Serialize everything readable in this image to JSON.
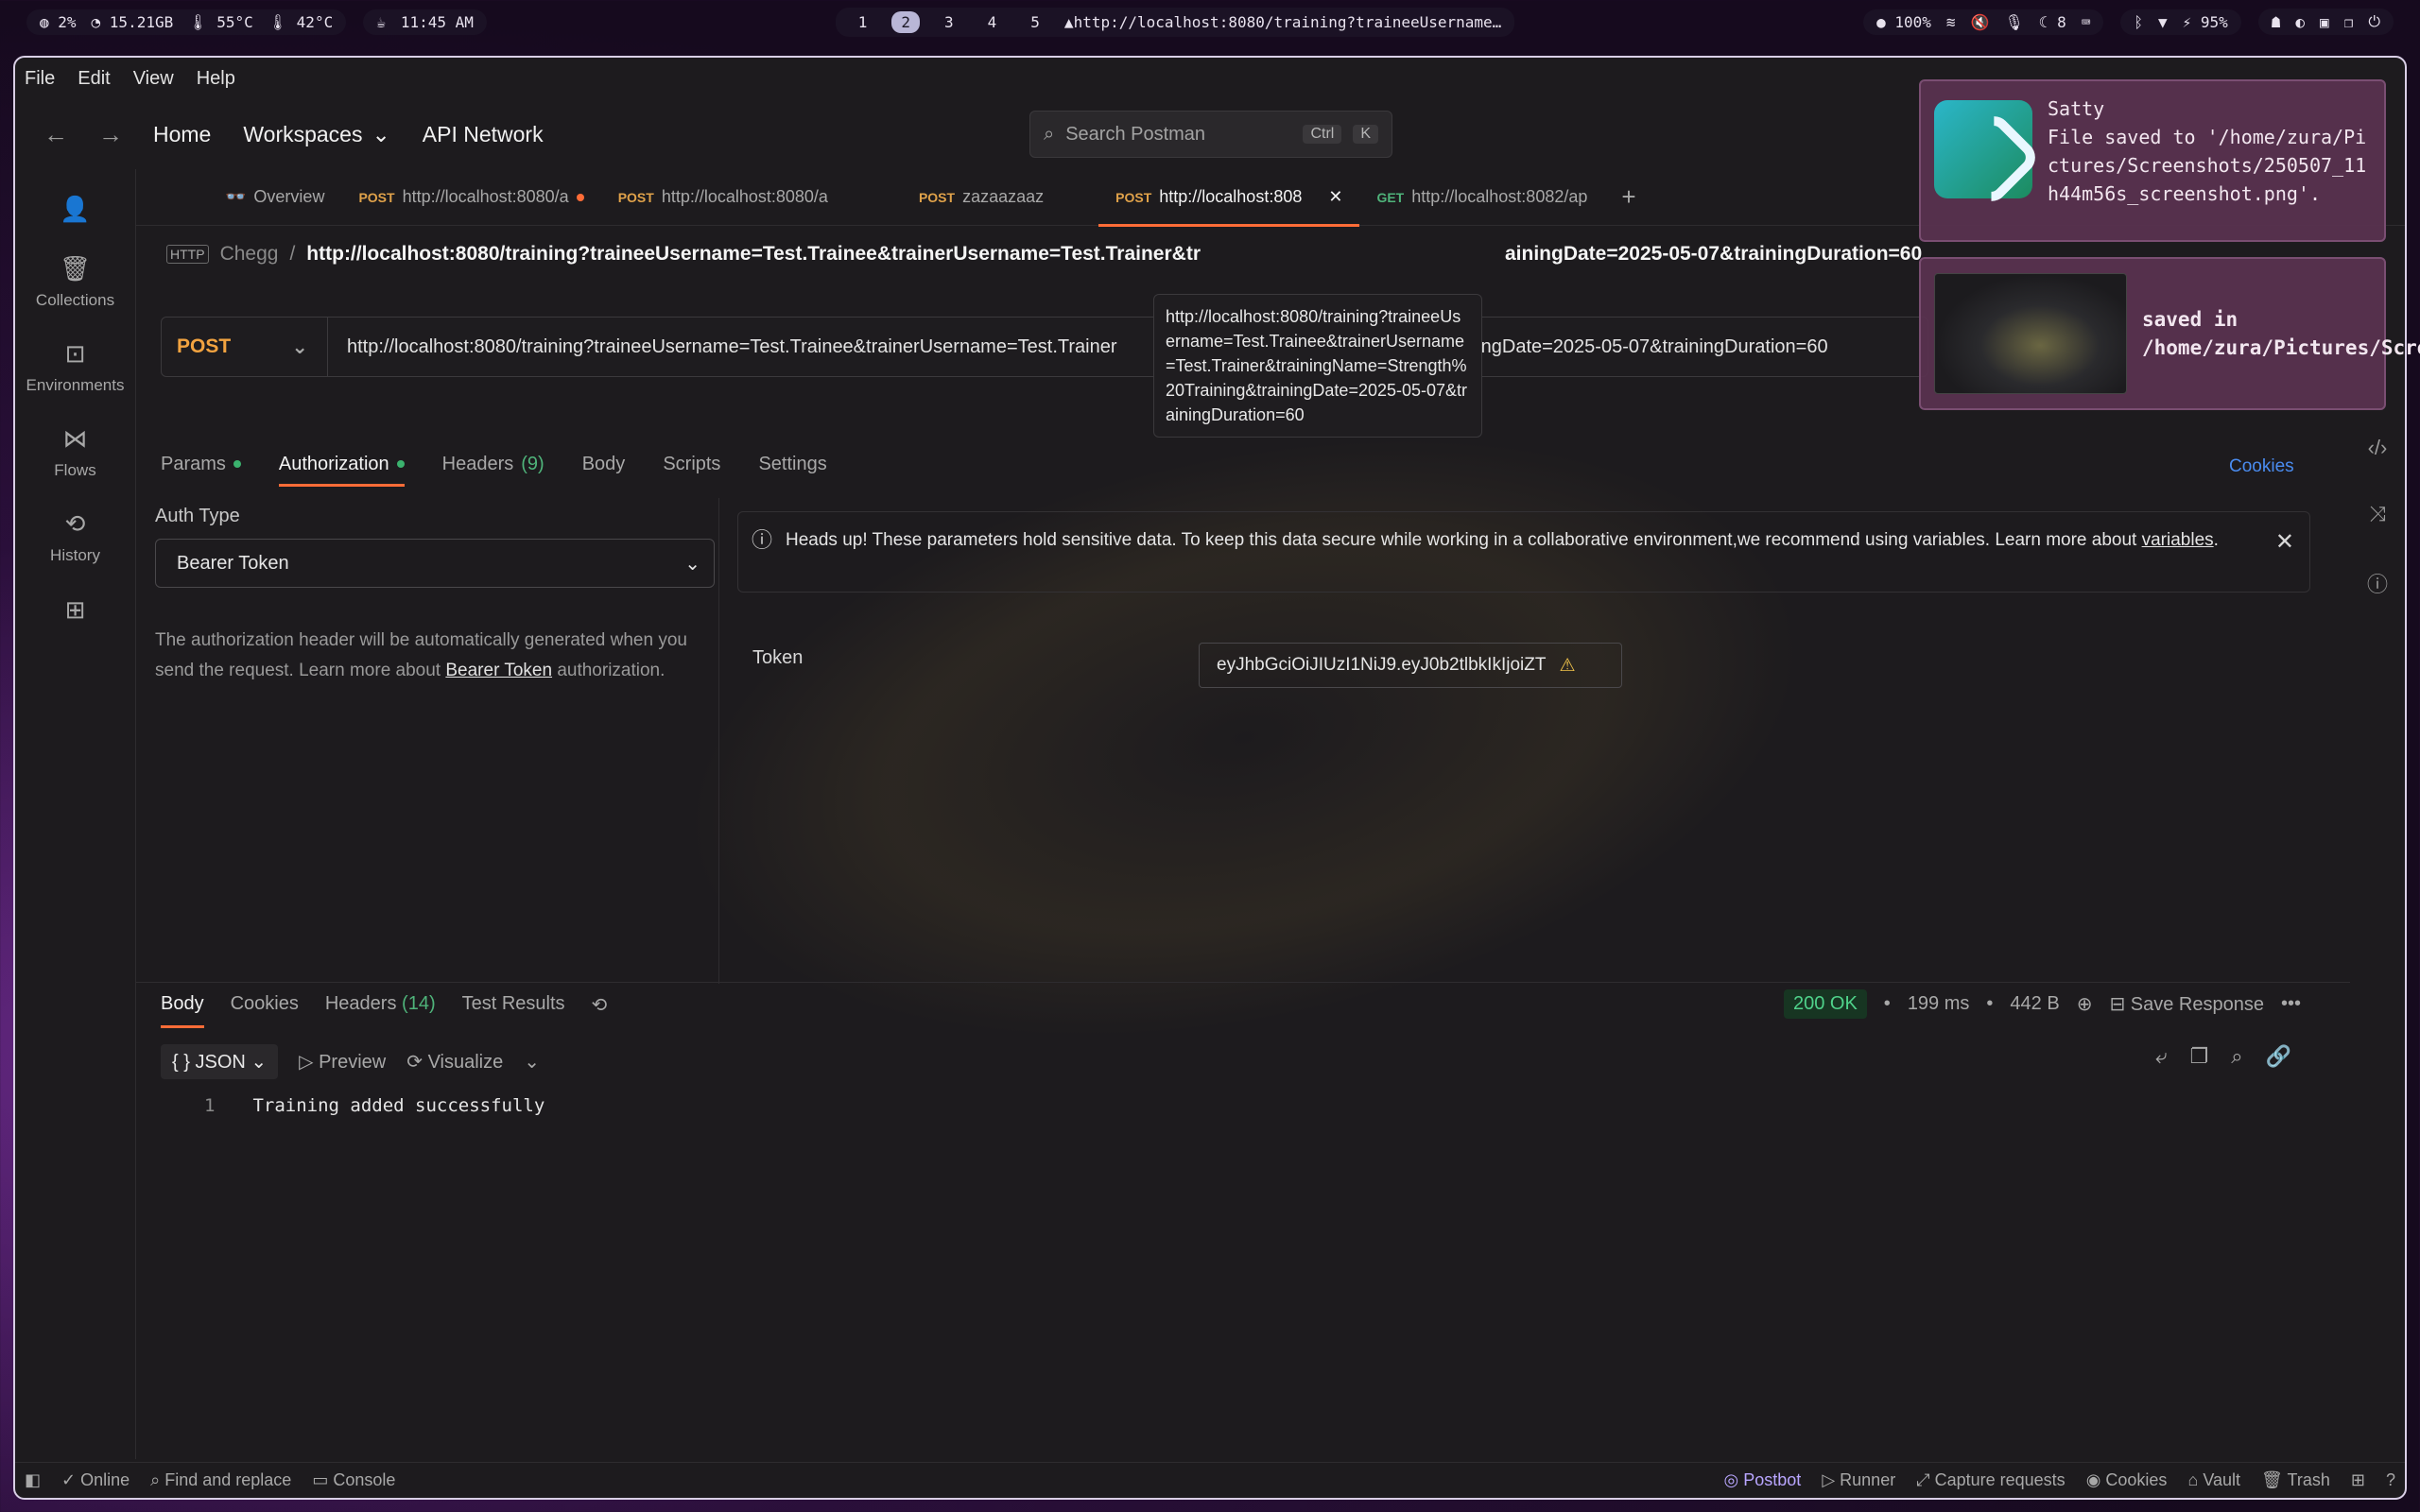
{
  "sysbar": {
    "cpu": "2%",
    "mem": "15.21GB",
    "temp1": "55°C",
    "temp2": "42°C",
    "time": "11:45 AM",
    "workspaces": [
      "1",
      "2",
      "3",
      "4",
      "5"
    ],
    "window_title": "http://localhost:8080/training?traineeUsername…",
    "volume": "100%",
    "notif_count": "8",
    "battery": "95%"
  },
  "menu": [
    "File",
    "Edit",
    "View",
    "Help"
  ],
  "nav": {
    "home": "Home",
    "workspaces": "Workspaces",
    "api_network": "API Network"
  },
  "search": {
    "placeholder": "Search Postman",
    "kbd1": "Ctrl",
    "kbd2": "K"
  },
  "sidebar": [
    {
      "label": "Collections"
    },
    {
      "label": "Environments"
    },
    {
      "label": "Flows"
    },
    {
      "label": "History"
    }
  ],
  "tabs": [
    {
      "method": "",
      "label": "Overview"
    },
    {
      "method": "POST",
      "label": "http://localhost:8080/a"
    },
    {
      "method": "POST",
      "label": "http://localhost:8080/a"
    },
    {
      "method": "POST",
      "label": "zazaazaaz"
    },
    {
      "method": "POST",
      "label": "http://localhost:808"
    },
    {
      "method": "GET",
      "label": "http://localhost:8082/ap"
    }
  ],
  "breadcrumb": {
    "collection": "Chegg",
    "url": "http://localhost:8080/training?traineeUsername=Test.Trainee&trainerUsername=Test.Trainer&tr",
    "url_tail": "ainingDate=2025-05-07&trainingDuration=60"
  },
  "request": {
    "method": "POST",
    "url": "http://localhost:8080/training?traineeUsername=Test.Trainee&trainerUsername=Test.Trainer",
    "url_tail": "ainingDate=2025-05-07&trainingDuration=60"
  },
  "tooltip": "http://localhost:8080/training?traineeUsername=Test.Trainee&trainerUsername=Test.Trainer&trainingName=Strength%20Training&trainingDate=2025-05-07&trainingDuration=60",
  "subtabs": {
    "params": "Params",
    "authorization": "Authorization",
    "headers": "Headers",
    "headers_count": "(9)",
    "body": "Body",
    "scripts": "Scripts",
    "settings": "Settings",
    "cookies": "Cookies"
  },
  "auth": {
    "type_label": "Auth Type",
    "type_value": "Bearer Token",
    "desc_pre": "The authorization header will be automatically generated when you send the request. Learn more about ",
    "desc_link": "Bearer Token",
    "desc_post": " authorization."
  },
  "warning": {
    "text": "Heads up! These parameters hold sensitive data. To keep this data secure while working in a collaborative environment,we recommend using variables. Learn more about ",
    "link": "variables",
    "end": "."
  },
  "token": {
    "label": "Token",
    "value": "eyJhbGciOiJIUzI1NiJ9.eyJ0b2tlbkIkIjoiZT"
  },
  "response": {
    "tabs": {
      "body": "Body",
      "cookies": "Cookies",
      "headers": "Headers",
      "headers_count": "(14)",
      "tests": "Test Results"
    },
    "status": "200 OK",
    "time": "199 ms",
    "size": "442 B",
    "save": "Save Response",
    "format": "JSON",
    "preview": "Preview",
    "visualize": "Visualize",
    "line_no": "1",
    "line": "Training added successfully"
  },
  "statusbar": {
    "online": "Online",
    "find": "Find and replace",
    "console": "Console",
    "postbot": "Postbot",
    "runner": "Runner",
    "capture": "Capture requests",
    "cookies": "Cookies",
    "vault": "Vault",
    "trash": "Trash"
  },
  "notifications": {
    "n1_title": "Satty",
    "n1_body": "File saved to '/home/zura/Pictures/Screenshots/250507_11h44m56s_screenshot.png'.",
    "n2_body": "saved in /home/zura/Pictures/Screenshots"
  }
}
